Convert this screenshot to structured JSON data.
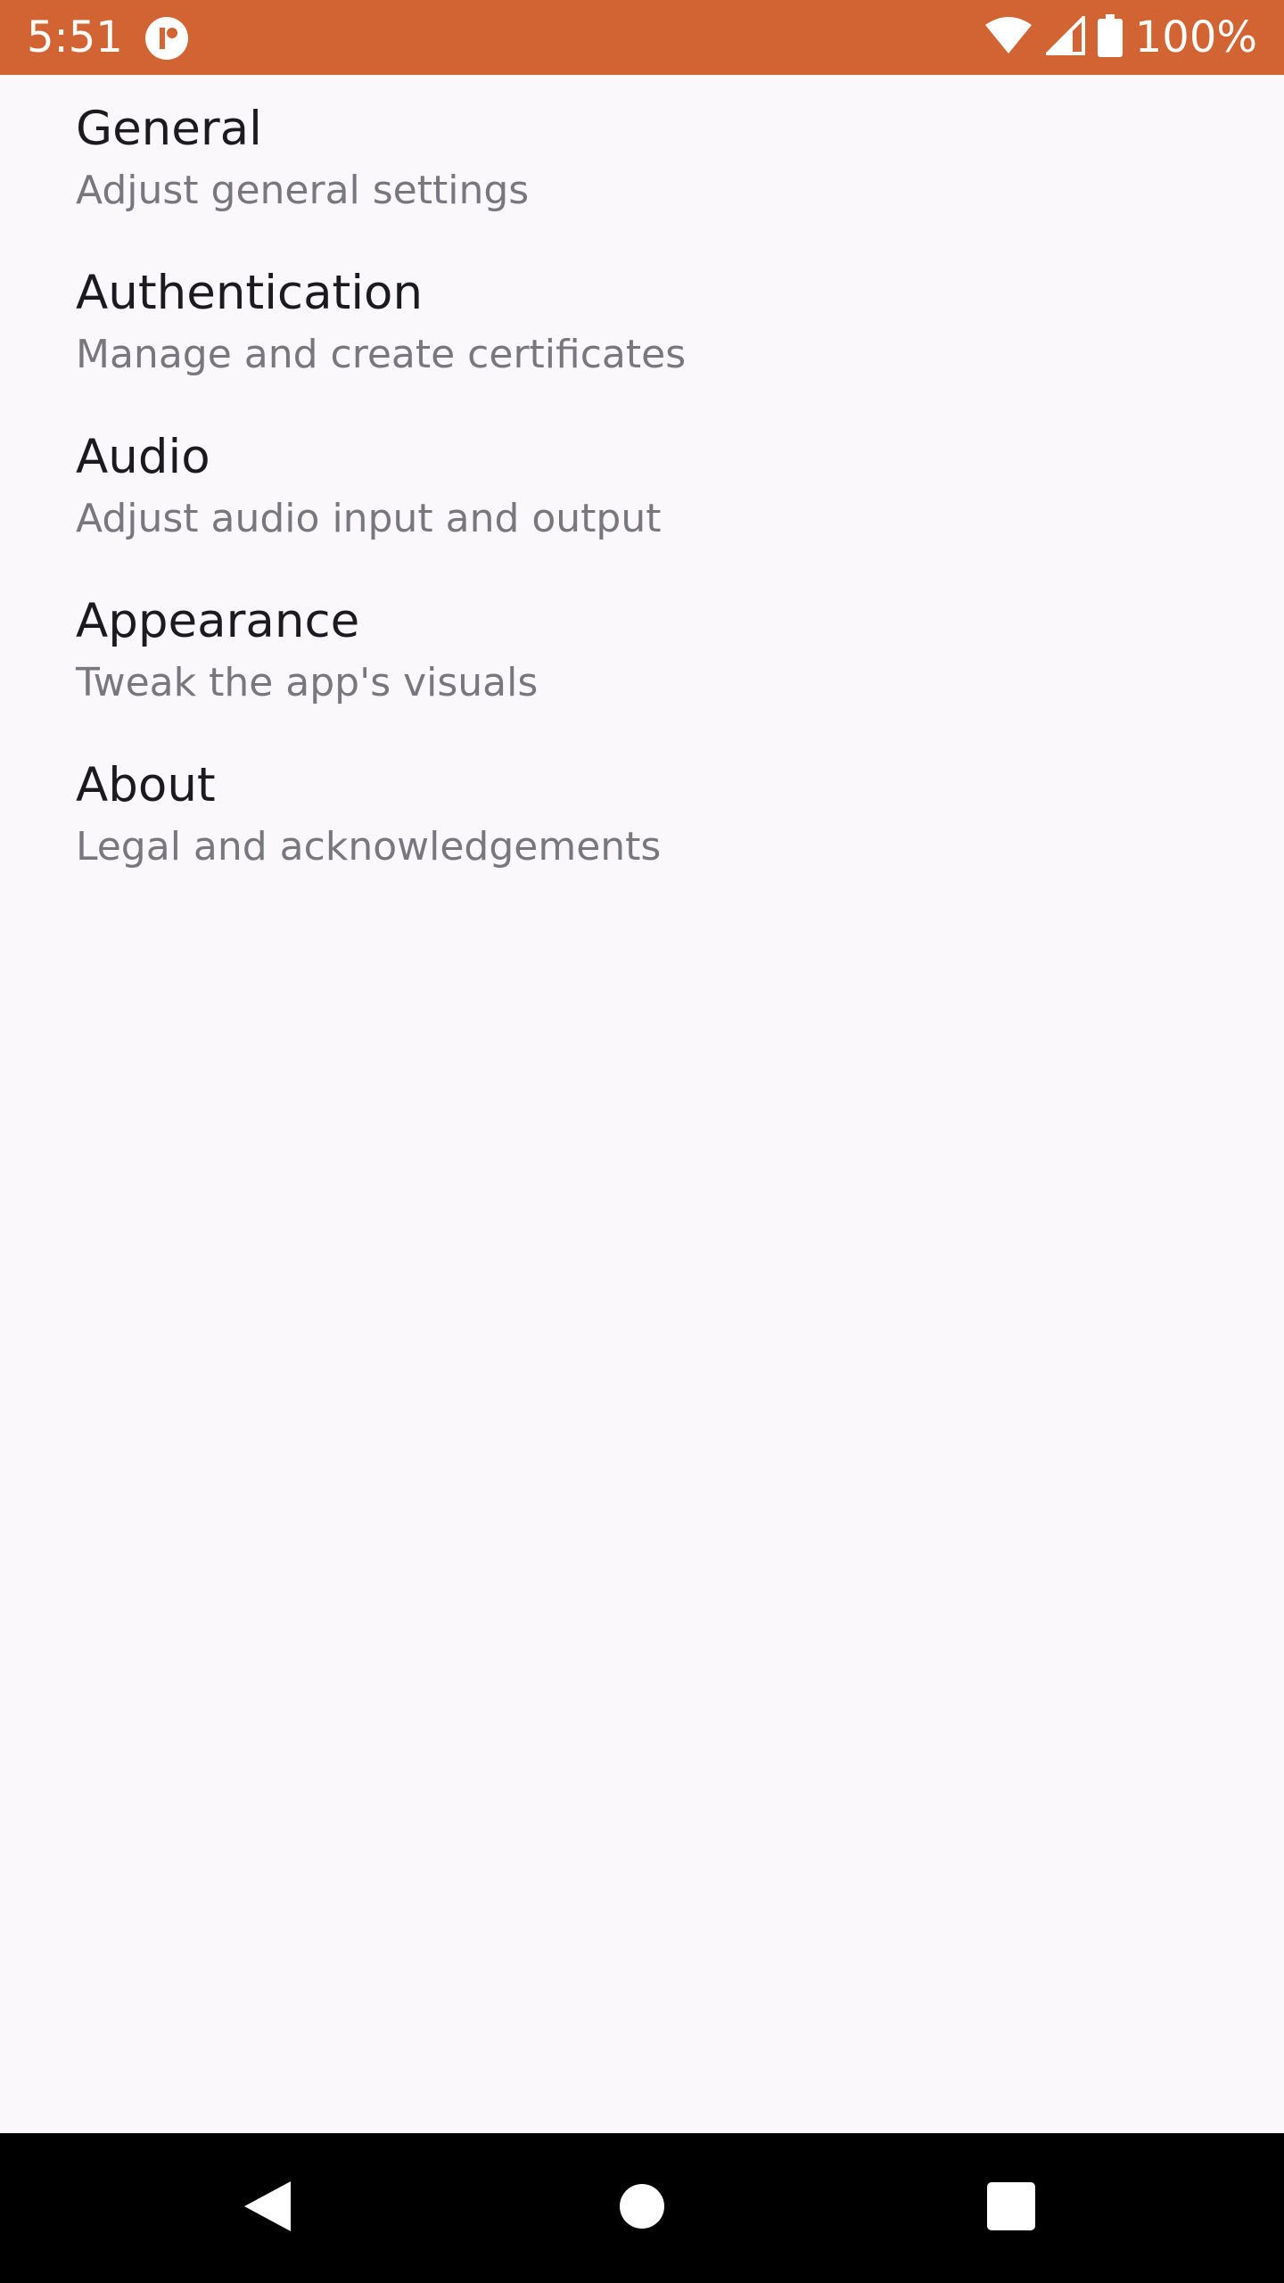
{
  "status_bar": {
    "time": "5:51",
    "battery_percent": "100%",
    "background_color": "#d26434",
    "icons": [
      "app-notification-icon",
      "wifi-icon",
      "cell-signal-icon",
      "battery-icon"
    ]
  },
  "settings": {
    "items": [
      {
        "title": "General",
        "subtitle": "Adjust general settings"
      },
      {
        "title": "Authentication",
        "subtitle": "Manage and create certificates"
      },
      {
        "title": "Audio",
        "subtitle": "Adjust audio input and output"
      },
      {
        "title": "Appearance",
        "subtitle": "Tweak the app's visuals"
      },
      {
        "title": "About",
        "subtitle": "Legal and acknowledgements"
      }
    ]
  },
  "nav_bar": {
    "icons": [
      "back-icon",
      "home-icon",
      "recents-icon"
    ]
  }
}
